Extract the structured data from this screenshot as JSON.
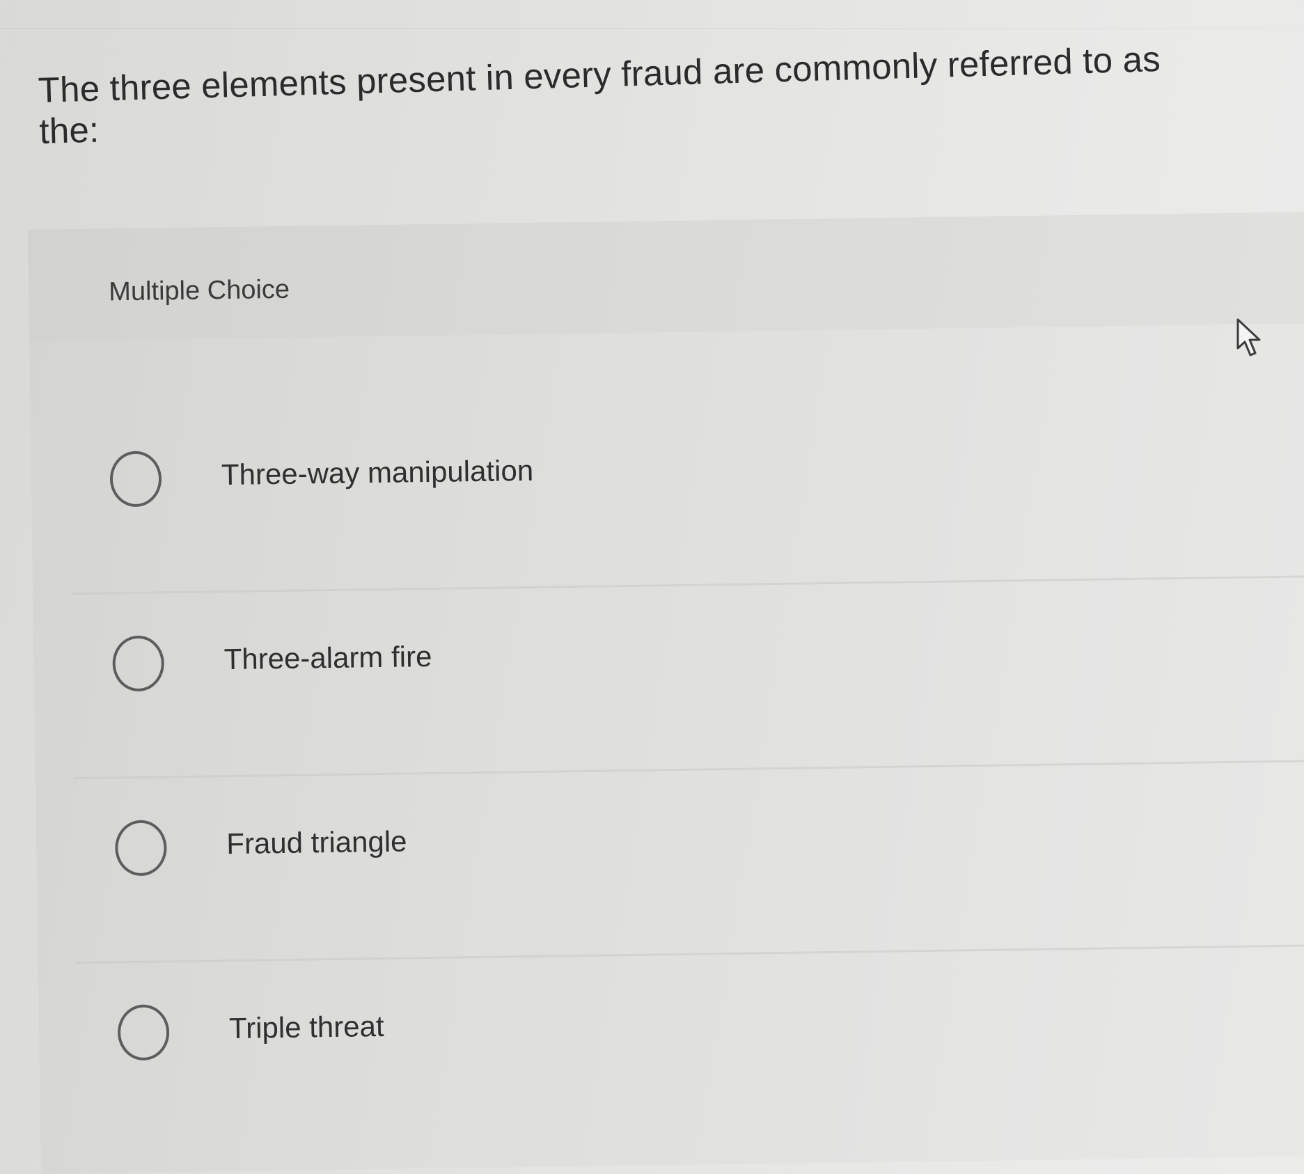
{
  "question": {
    "text": "The three elements present in every fraud are commonly referred to as the:"
  },
  "panel": {
    "label": "Multiple Choice"
  },
  "options": [
    {
      "label": "Three-way manipulation"
    },
    {
      "label": "Three-alarm fire"
    },
    {
      "label": "Fraud triangle"
    },
    {
      "label": "Triple threat"
    }
  ],
  "icons": {
    "cursor": "mouse-pointer-icon",
    "radio": "radio-unselected-icon"
  },
  "colors": {
    "text": "#2b2b2b",
    "radio_border": "#5d5d5d",
    "background": "#e3e3e1"
  }
}
